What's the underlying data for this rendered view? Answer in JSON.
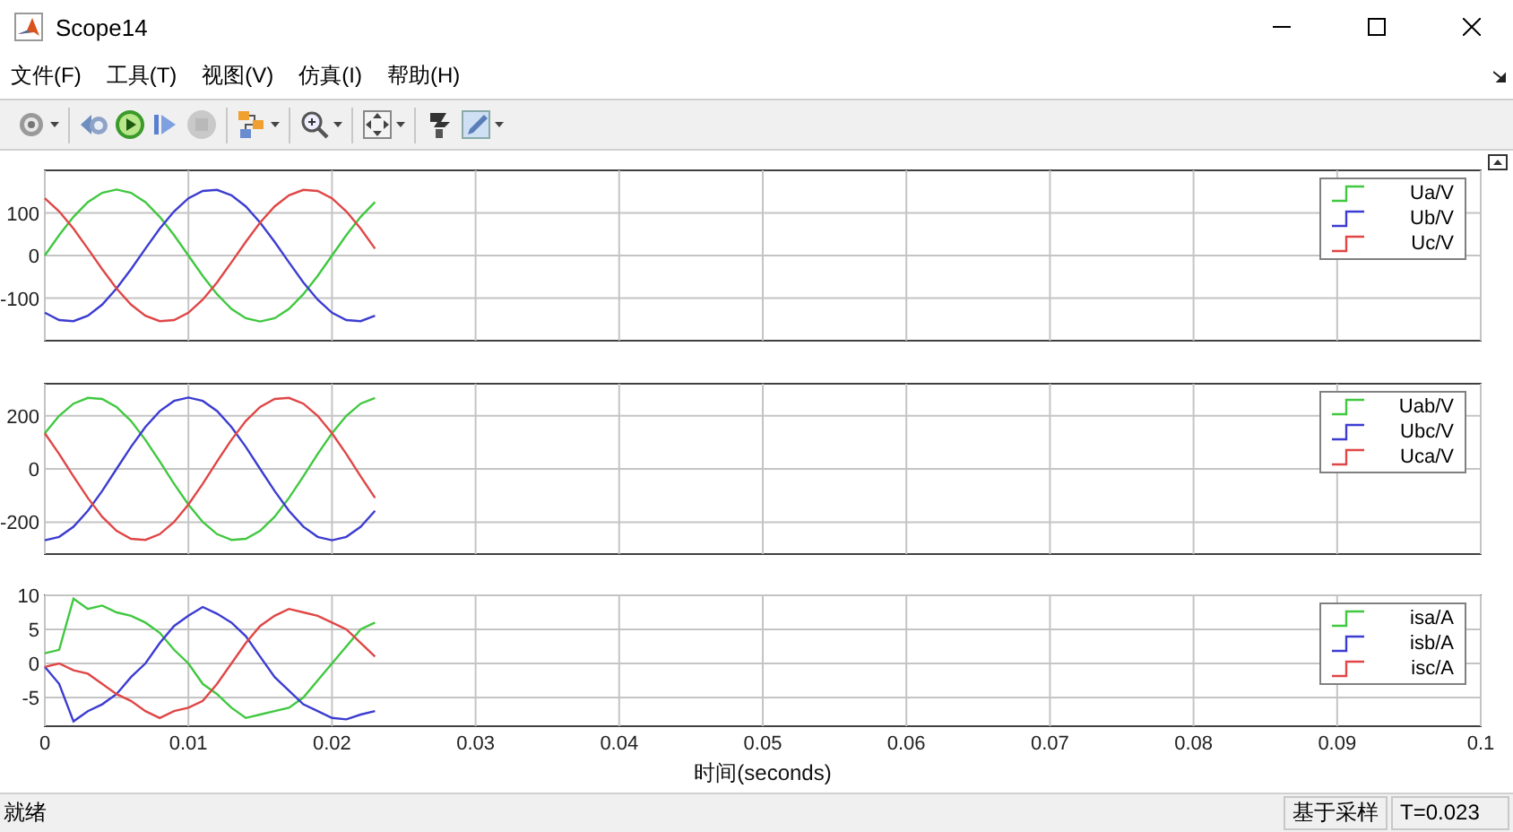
{
  "window": {
    "title": "Scope14"
  },
  "menu": [
    "文件(F)",
    "工具(T)",
    "视图(V)",
    "仿真(I)",
    "帮助(H)"
  ],
  "toolbar": [
    {
      "items": [
        {
          "kind": "settings",
          "dropdown": true,
          "disabled": false
        }
      ]
    },
    {
      "items": [
        {
          "kind": "step-back",
          "dropdown": false,
          "disabled": false
        },
        {
          "kind": "run",
          "dropdown": false,
          "disabled": false
        },
        {
          "kind": "step-forward",
          "dropdown": false,
          "disabled": false
        },
        {
          "kind": "stop",
          "dropdown": false,
          "disabled": true
        }
      ]
    },
    {
      "items": [
        {
          "kind": "signals",
          "dropdown": true,
          "disabled": false
        }
      ]
    },
    {
      "items": [
        {
          "kind": "zoom",
          "dropdown": true,
          "disabled": false
        }
      ]
    },
    {
      "items": [
        {
          "kind": "fit",
          "dropdown": true,
          "disabled": false
        }
      ]
    },
    {
      "items": [
        {
          "kind": "highlight",
          "dropdown": false,
          "disabled": false
        },
        {
          "kind": "style",
          "dropdown": true,
          "disabled": false
        }
      ]
    }
  ],
  "plots": [
    {
      "chart_data": {
        "type": "line",
        "grid": true,
        "x": [
          0,
          0.001,
          0.002,
          0.003,
          0.004,
          0.005,
          0.006,
          0.007,
          0.008,
          0.009,
          0.01,
          0.011,
          0.012,
          0.013,
          0.014,
          0.015,
          0.016,
          0.017,
          0.018,
          0.019,
          0.02,
          0.021,
          0.022,
          0.023
        ],
        "xlim": [
          0,
          0.1
        ],
        "ylim": [
          -200,
          200
        ],
        "yticks": [
          -100,
          0,
          100
        ],
        "series": [
          {
            "name": "Ua/V",
            "color": "#40c840",
            "values": [
              0,
              47.9,
              91.1,
              125.4,
              147.4,
              155,
              147.4,
              125.4,
              91.1,
              47.9,
              0,
              -47.9,
              -91.1,
              -125.4,
              -147.4,
              -155,
              -147.4,
              -125.4,
              -91.1,
              -47.9,
              0,
              47.9,
              91.1,
              125.4
            ]
          },
          {
            "name": "Ub/V",
            "color": "#3c3cd2",
            "values": [
              -134.2,
              -151.6,
              -154.2,
              -141.6,
              -115.2,
              -77.5,
              -32.2,
              16.2,
              63,
              103.7,
              134.2,
              151.6,
              154.2,
              141.6,
              115.2,
              77.5,
              32.2,
              -16.2,
              -63,
              -103.7,
              -134.2,
              -151.6,
              -154.2,
              -141.6
            ]
          },
          {
            "name": "Uc/V",
            "color": "#e04646",
            "values": [
              134.2,
              103.7,
              63.1,
              16.2,
              -32.2,
              -77.5,
              -115.2,
              -141.6,
              -154.1,
              -151.6,
              -134.2,
              -103.7,
              -63.1,
              -16.2,
              32.2,
              77.5,
              115.2,
              141.6,
              154.1,
              151.6,
              134.2,
              103.7,
              63.1,
              16.2
            ]
          }
        ]
      }
    },
    {
      "chart_data": {
        "type": "line",
        "grid": true,
        "x": [
          0,
          0.001,
          0.002,
          0.003,
          0.004,
          0.005,
          0.006,
          0.007,
          0.008,
          0.009,
          0.01,
          0.011,
          0.012,
          0.013,
          0.014,
          0.015,
          0.016,
          0.017,
          0.018,
          0.019,
          0.02,
          0.021,
          0.022,
          0.023
        ],
        "xlim": [
          0,
          0.1
        ],
        "ylim": [
          -320,
          320
        ],
        "yticks": [
          -200,
          0,
          200
        ],
        "series": [
          {
            "name": "Uab/V",
            "color": "#40c840",
            "values": [
              134.2,
              199.5,
              245.3,
              267,
              262.6,
              232.5,
              179.6,
              109.2,
              28.1,
              -55.8,
              -134.2,
              -199.5,
              -245.3,
              -267,
              -262.6,
              -232.5,
              -179.6,
              -109.2,
              -28.1,
              55.8,
              134.2,
              199.5,
              245.3,
              267
            ]
          },
          {
            "name": "Ubc/V",
            "color": "#3c3cd2",
            "values": [
              -268.4,
              -255.3,
              -217.3,
              -157.8,
              -83,
              0,
              83,
              157.8,
              217.1,
              255.3,
              268.4,
              255.3,
              217.3,
              157.8,
              83,
              0,
              -83,
              -157.8,
              -217.1,
              -255.3,
              -268.4,
              -255.3,
              -217.3,
              -157.8
            ]
          },
          {
            "name": "Uca/V",
            "color": "#e04646",
            "values": [
              134.2,
              55.8,
              -28,
              -109.2,
              -179.6,
              -232.5,
              -262.6,
              -267,
              -245.2,
              -199.5,
              -134.2,
              -55.8,
              28,
              109.2,
              179.6,
              232.5,
              262.6,
              267,
              245.2,
              199.5,
              134.2,
              55.8,
              -28,
              -109.2
            ]
          }
        ]
      }
    },
    {
      "chart_data": {
        "type": "line",
        "grid": true,
        "xlabel": "时间(seconds)",
        "x": [
          0,
          0.001,
          0.002,
          0.003,
          0.004,
          0.005,
          0.006,
          0.007,
          0.008,
          0.009,
          0.01,
          0.011,
          0.012,
          0.013,
          0.014,
          0.015,
          0.016,
          0.017,
          0.018,
          0.019,
          0.02,
          0.021,
          0.022,
          0.023
        ],
        "xlim": [
          0,
          0.1
        ],
        "ylim": [
          -9.2,
          10
        ],
        "xticks": [
          0,
          0.01,
          0.02,
          0.03,
          0.04,
          0.05,
          0.06,
          0.07,
          0.08,
          0.09,
          0.1
        ],
        "yticks": [
          -5,
          0,
          5,
          10
        ],
        "series": [
          {
            "name": "isa/A",
            "color": "#40c840",
            "values": [
              1.5,
              2,
              9.5,
              8,
              8.5,
              7.5,
              7,
              6,
              4.5,
              2,
              0,
              -3,
              -4.5,
              -6.5,
              -8,
              -7.5,
              -7,
              -6.5,
              -5,
              -2.5,
              0,
              2.5,
              5,
              6
            ]
          },
          {
            "name": "isb/A",
            "color": "#3c3cd2",
            "values": [
              -0.5,
              -3,
              -8.5,
              -7,
              -6,
              -4.5,
              -2,
              0,
              3,
              5.5,
              7,
              8.3,
              7.3,
              6,
              4,
              1,
              -2,
              -4,
              -6,
              -7,
              -8,
              -8.2,
              -7.5,
              -7
            ]
          },
          {
            "name": "isc/A",
            "color": "#e04646",
            "values": [
              -0.5,
              0,
              -1,
              -1.5,
              -3,
              -4.5,
              -5.5,
              -7,
              -8,
              -7,
              -6.5,
              -5.5,
              -3,
              0,
              3,
              5.5,
              7,
              8,
              7.5,
              7,
              6,
              5,
              3,
              1
            ]
          }
        ]
      }
    }
  ],
  "status_bar": {
    "message": "就绪",
    "mode": "基于采样",
    "time": "T=0.023"
  }
}
